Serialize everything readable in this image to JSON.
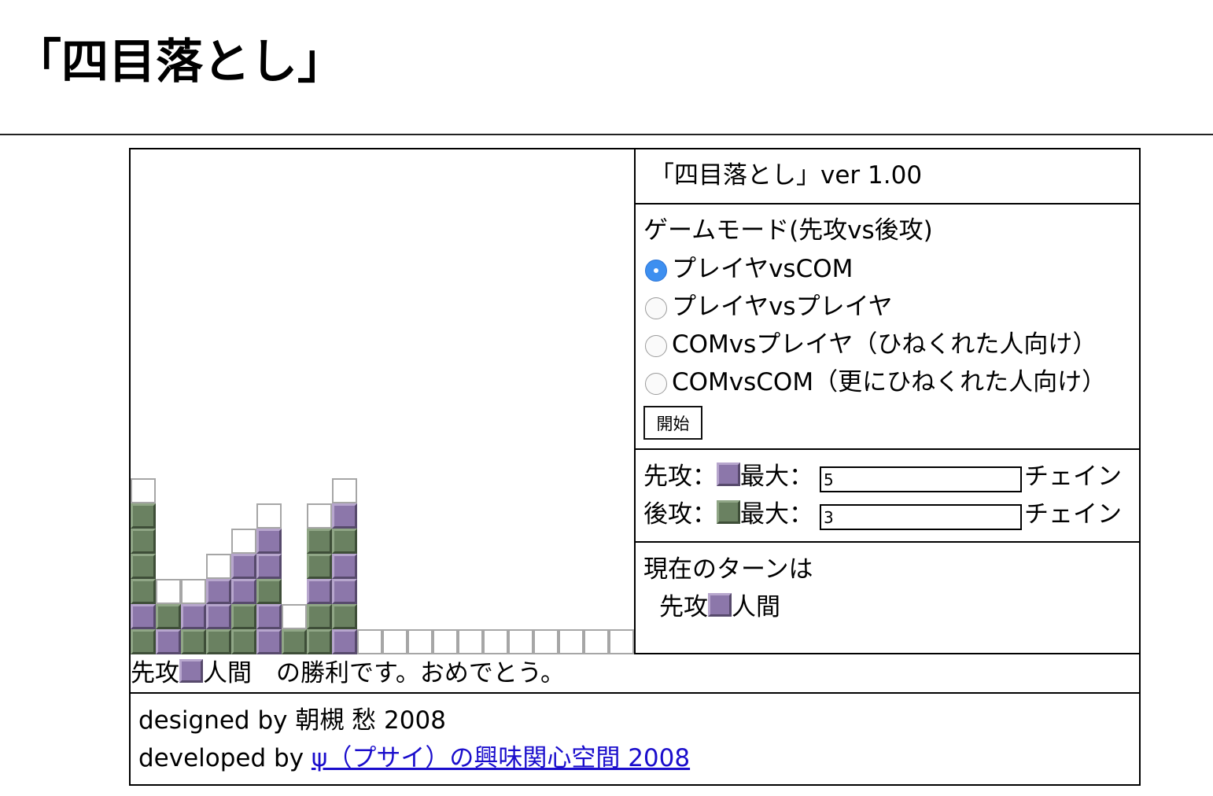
{
  "page": {
    "title": "「四目落とし」"
  },
  "side": {
    "version": "「四目落とし」ver 1.00",
    "mode_title": "ゲームモード(先攻vs後攻)",
    "modes": [
      {
        "label": "プレイヤvsCOM",
        "selected": true
      },
      {
        "label": "プレイヤvsプレイヤ",
        "selected": false
      },
      {
        "label": "COMvsプレイヤ（ひねくれた人向け）",
        "selected": false
      },
      {
        "label": "COMvsCOM（更にひねくれた人向け）",
        "selected": false
      }
    ],
    "start_label": "開始",
    "first": {
      "label": "先攻：",
      "max_label": "最大：",
      "value": "5",
      "suffix": "チェイン"
    },
    "second": {
      "label": "後攻：",
      "max_label": "最大：",
      "value": "3",
      "suffix": "チェイン"
    },
    "turn_title": "現在のターンは",
    "turn_prefix": "先攻",
    "turn_suffix": "人間"
  },
  "result": {
    "prefix": "先攻",
    "suffix": "人間　の勝利です。おめでとう。"
  },
  "footer": {
    "designed": "designed by 朝槻 愁 2008",
    "developed_prefix": "developed by ",
    "link_text": "ψ（プサイ）の興味関心空間 2008"
  },
  "colors": {
    "first_piece": "#8c77aa",
    "second_piece": "#6a8161"
  },
  "board": {
    "columns": 20,
    "pieces_bottom_up": [
      [
        "g",
        "p",
        "g",
        "g",
        "g",
        "g"
      ],
      [
        "p",
        "g"
      ],
      [
        "g",
        "p"
      ],
      [
        "g",
        "p",
        "p"
      ],
      [
        "g",
        "g",
        "p",
        "p"
      ],
      [
        "p",
        "p",
        "g",
        "p",
        "p"
      ],
      [
        "g"
      ],
      [
        "g",
        "g",
        "p",
        "g",
        "g"
      ],
      [
        "p",
        "g",
        "p",
        "p",
        "g",
        "p"
      ],
      [],
      [],
      [],
      [],
      [],
      [],
      [],
      [],
      [],
      [],
      []
    ]
  }
}
